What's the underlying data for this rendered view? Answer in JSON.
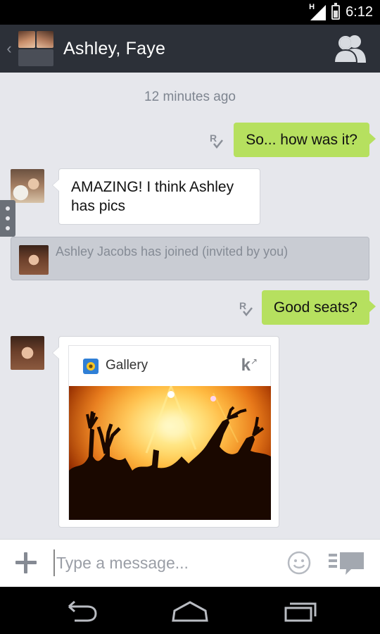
{
  "status_bar": {
    "network": "H",
    "time": "6:12"
  },
  "header": {
    "title": "Ashley, Faye",
    "back_icon": "chevron-left-icon",
    "members_icon": "members-icon"
  },
  "chat": {
    "timestamp": "12 minutes ago",
    "messages": [
      {
        "side": "right",
        "text": "So... how was it?"
      },
      {
        "side": "left",
        "sender": "Faye",
        "text_line1": "AMAZING! I think Ashley",
        "text_line2": "has pics"
      },
      {
        "side": "system",
        "text": "Ashley Jacobs has joined (invited by you)"
      },
      {
        "side": "right",
        "text": "Good seats?"
      },
      {
        "side": "left",
        "sender": "Ashley",
        "card_title": "Gallery",
        "card_app_icon": "k-share-icon"
      }
    ]
  },
  "composer": {
    "placeholder": "Type a message..."
  },
  "colors": {
    "outgoing_bubble": "#b6e05f",
    "header_bg": "#2c3038",
    "chat_bg": "#e6e7ec"
  }
}
